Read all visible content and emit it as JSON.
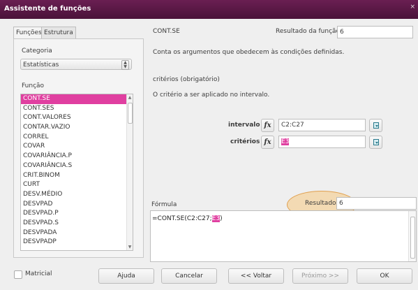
{
  "window": {
    "title": "Assistente de funções",
    "close_glyph": "×"
  },
  "tabs": [
    {
      "label": "Funções"
    },
    {
      "label": "Estrutura"
    }
  ],
  "left": {
    "category_label": "Categoria",
    "category_value": "Estatísticas",
    "function_label": "Função",
    "functions": [
      "CONT.SE",
      "CONT.SES",
      "CONT.VALORES",
      "CONTAR.VAZIO",
      "CORREL",
      "COVAR",
      "COVARIÂNCIA.P",
      "COVARIÂNCIA.S",
      "CRIT.BINOM",
      "CURT",
      "DESV.MÉDIO",
      "DESVPAD",
      "DESVPAD.P",
      "DESVPAD.S",
      "DESVPADA",
      "DESVPADP"
    ],
    "selected_index": 0
  },
  "right": {
    "function_name": "CONT.SE",
    "result_label": "Resultado da função",
    "result_value": "6",
    "description": "Conta os argumentos que obedecem às condições definidas.",
    "arg_title": "critérios (obrigatório)",
    "arg_description": "O critério a ser aplicado no intervalo.",
    "args": [
      {
        "label": "intervalo",
        "value": "C2:C27"
      },
      {
        "label": "critérios",
        "value": "E3"
      }
    ],
    "fx_glyph": "fx"
  },
  "formula": {
    "label": "Fórmula",
    "result_label": "Resultado",
    "result_value": "6",
    "text_before": "=CONT.SE(C2:C27;",
    "text_highlight": "E3",
    "text_after": ")"
  },
  "footer": {
    "matrix_label": "Matricial",
    "help": "Ajuda",
    "cancel": "Cancelar",
    "back": "<< Voltar",
    "next": "Próximo >>",
    "ok": "OK"
  },
  "colors": {
    "accent": "#e03fa0",
    "titlebar": "#5a1846",
    "highlight_ellipse": "#f5c882"
  }
}
